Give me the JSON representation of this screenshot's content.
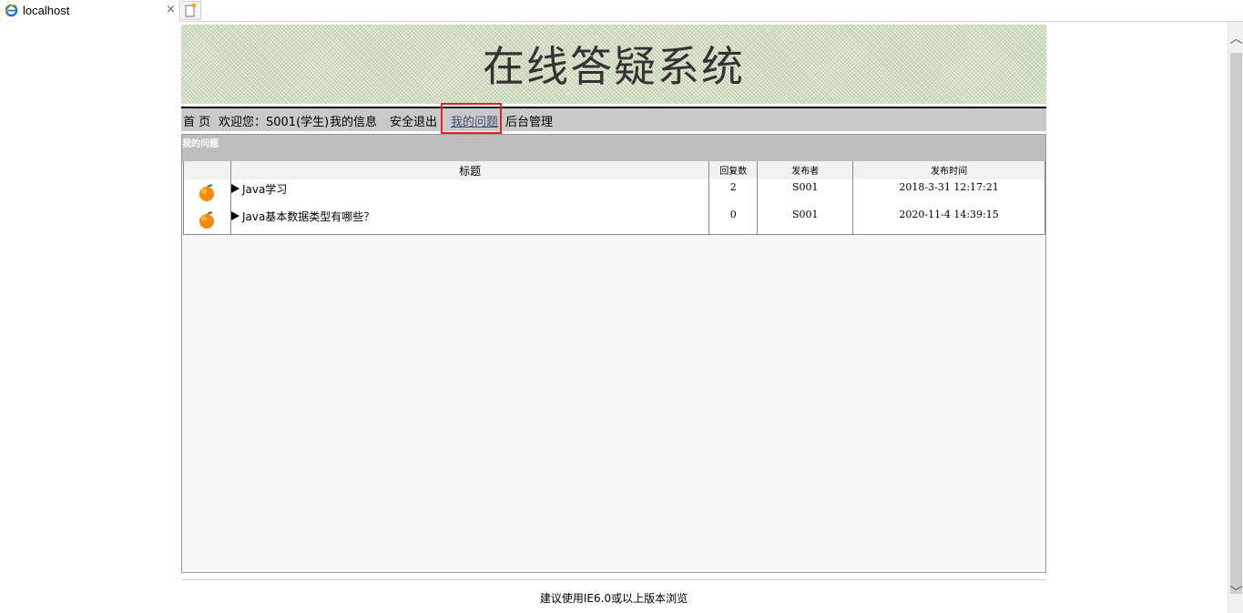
{
  "browser": {
    "tab_title": "localhost",
    "close_glyph": "×",
    "icons": {
      "tab": "ie-logo-icon",
      "new_tab": "new-tab-icon"
    }
  },
  "header": {
    "title": "在线答疑系统"
  },
  "nav": {
    "home": "首 页",
    "welcome": "欢迎您：S001(学生)",
    "my_info": "我的信息",
    "logout": "安全退出",
    "my_questions": "我的问题",
    "admin": "后台管理"
  },
  "panel": {
    "title": "我的问题",
    "columns": [
      "标题",
      "回复数",
      "发布者",
      "发布时间"
    ],
    "rows": [
      {
        "title": "Java学习",
        "replies": "2",
        "author": "S001",
        "time": "2018-3-31 12:17:21"
      },
      {
        "title": "Java基本数据类型有哪些？",
        "replies": "0",
        "author": "S001",
        "time": "2020-11-4 14:39:15"
      }
    ]
  },
  "footer": {
    "text": "建议使用IE6.0或以上版本浏览"
  },
  "colors": {
    "highlight": "#e12525",
    "nav_bg": "#c9c9c9",
    "banner_bg": "#cfdcc0",
    "active_link": "#3e4d7a"
  }
}
